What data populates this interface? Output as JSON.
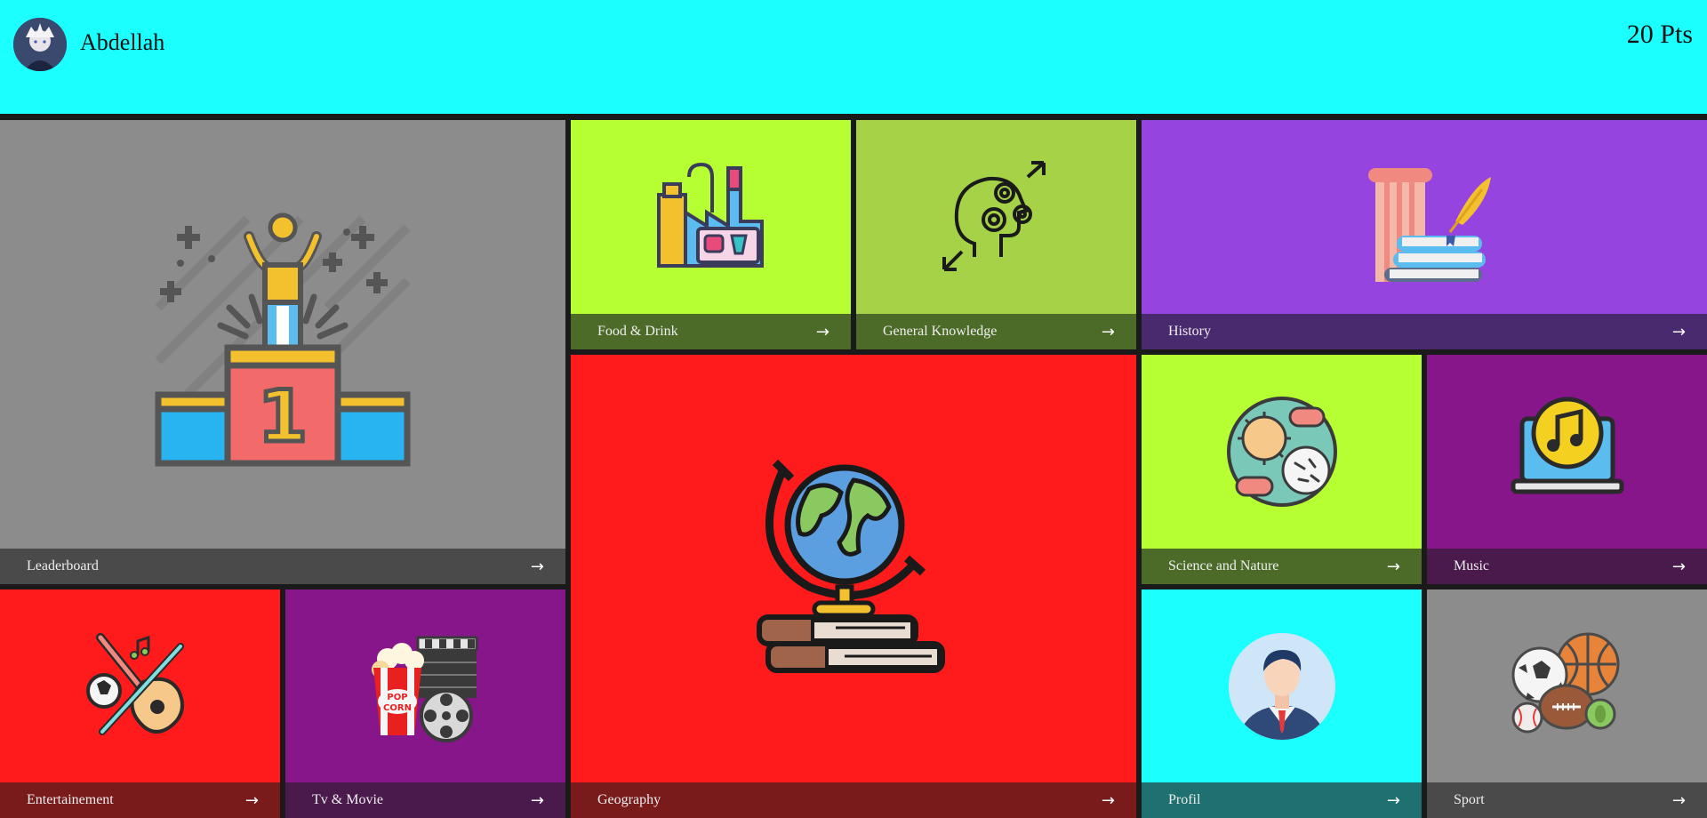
{
  "user": {
    "name": "Abdellah",
    "points": "20 Pts"
  },
  "tiles": {
    "leaderboard": {
      "label": "Leaderboard",
      "color": "#8c8c8c",
      "bar": "#4a4a4a"
    },
    "food": {
      "label": "Food & Drink",
      "color": "#b6ff33",
      "bar": "#4d6b28"
    },
    "general": {
      "label": "General Knowledge",
      "color": "#a6d247",
      "bar": "#4d6b28"
    },
    "history": {
      "label": "History",
      "color": "#9644e0",
      "bar": "#4a2a6e"
    },
    "geography": {
      "label": "Geography",
      "color": "#ff1b1b",
      "bar": "#7a1b1b"
    },
    "science": {
      "label": "Science and Nature",
      "color": "#b6ff33",
      "bar": "#4d6b28"
    },
    "music": {
      "label": "Music",
      "color": "#87168a",
      "bar": "#4a1a4d"
    },
    "entertainment": {
      "label": "Entertainement",
      "color": "#ff1b1b",
      "bar": "#7a1b1b"
    },
    "tvmovie": {
      "label": "Tv & Movie",
      "color": "#87168a",
      "bar": "#4a1a4d"
    },
    "profil": {
      "label": "Profil",
      "color": "#1cffff",
      "bar": "#1f7070"
    },
    "sport": {
      "label": "Sport",
      "color": "#8c8c8c",
      "bar": "#4a4a4a"
    }
  },
  "icons": {
    "leaderboard": "podium-icon",
    "food": "food-factory-icon",
    "general": "head-gears-icon",
    "history": "column-books-icon",
    "geography": "globe-books-icon",
    "science": "microbes-icon",
    "music": "laptop-music-icon",
    "entertainment": "guitar-icon",
    "tvmovie": "popcorn-film-icon",
    "profil": "businessman-avatar-icon",
    "sport": "sports-balls-icon",
    "arrow": "arrow-right-icon"
  }
}
